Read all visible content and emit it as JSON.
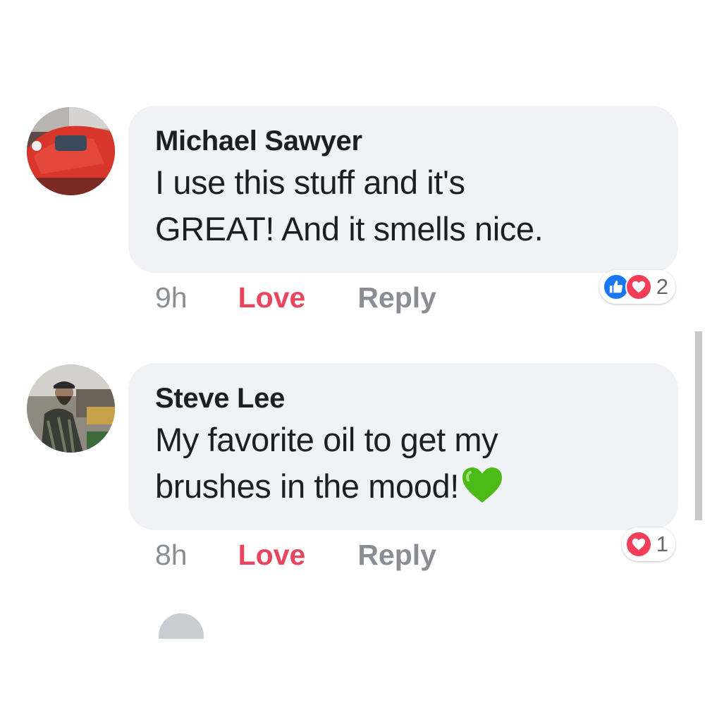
{
  "comments": [
    {
      "author": "Michael Sawyer",
      "text_lines": [
        "I use this stuff and it's",
        "GREAT! And it smells nice."
      ],
      "time": "9h",
      "love_label": "Love",
      "reply_label": "Reply",
      "reactions": [
        "like",
        "love"
      ],
      "reaction_count": "2"
    },
    {
      "author": "Steve Lee",
      "text_lines": [
        "My favorite oil to get my",
        "brushes in the mood!"
      ],
      "emoji": "green-heart",
      "time": "8h",
      "love_label": "Love",
      "reply_label": "Reply",
      "reactions": [
        "love"
      ],
      "reaction_count": "1"
    }
  ],
  "colors": {
    "bubble": "#f0f2f5",
    "love": "#e8455f",
    "muted": "#8a8d91",
    "like_blue": "#1877f2",
    "heart_red": "#f33e58",
    "emoji_green": "#4cbb17"
  }
}
